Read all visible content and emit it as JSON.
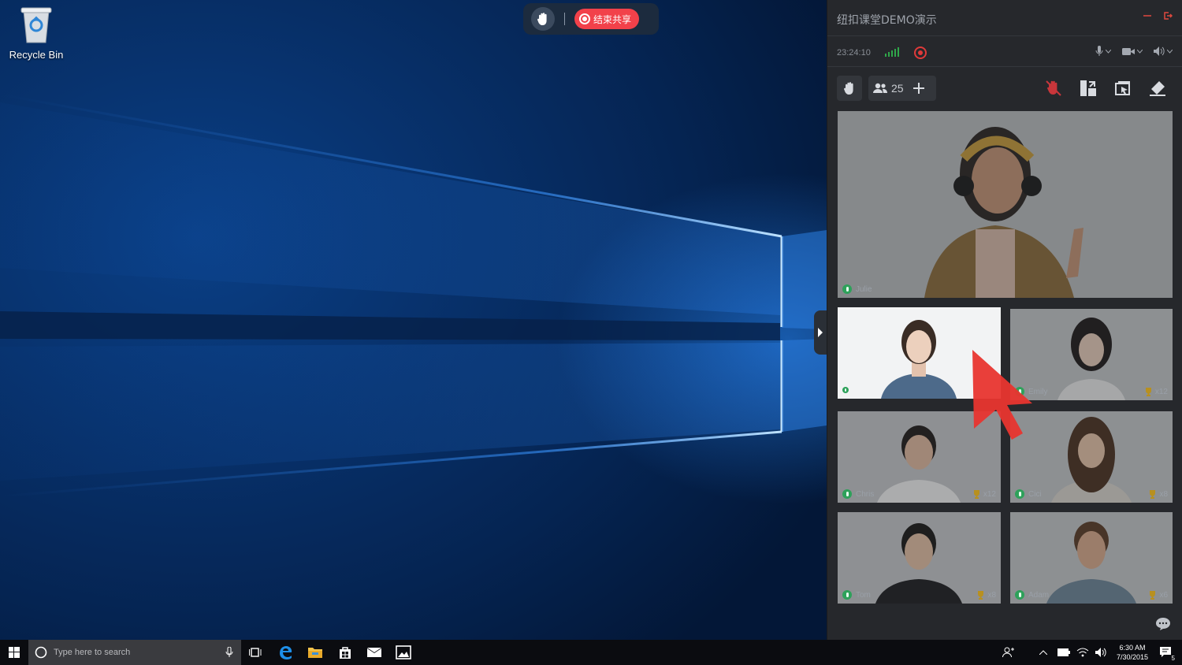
{
  "desktop": {
    "recycle_bin_label": "Recycle Bin"
  },
  "share_toolbar": {
    "raise_hand_icon": "hand-icon",
    "end_share_label": "结束共享"
  },
  "panel": {
    "title": "纽扣课堂DEMO演示",
    "status": {
      "time": "23:24:10",
      "signal": "good",
      "recording": true
    },
    "toolbar": {
      "participant_count": "25"
    },
    "colors": {
      "accent_red": "#f2414a",
      "signal_green": "#2fa74a",
      "panel_bg": "#26282c"
    },
    "participants": [
      {
        "name": "Julie",
        "trophies": ""
      },
      {
        "name": "",
        "trophies": ""
      },
      {
        "name": "Emily",
        "trophies": "x12"
      },
      {
        "name": "Chris",
        "trophies": "x12"
      },
      {
        "name": "Cici",
        "trophies": "x8"
      },
      {
        "name": "Tom",
        "trophies": "x8"
      },
      {
        "name": "Adam",
        "trophies": "x6"
      }
    ]
  },
  "taskbar": {
    "search_placeholder": "Type here to search",
    "clock_time": "6:30 AM",
    "clock_date": "7/30/2015",
    "notification_count": "5"
  }
}
